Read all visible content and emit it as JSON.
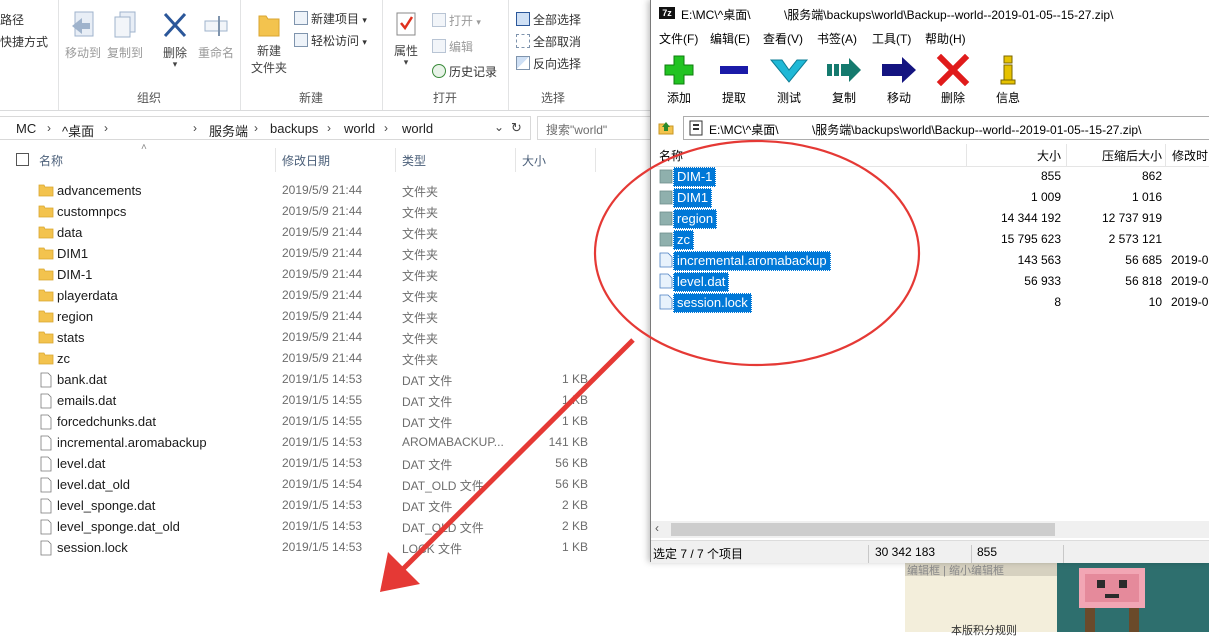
{
  "explorer": {
    "ribbon": {
      "left_edge": {
        "path_label": "路径",
        "shortcut_label": "快捷方式"
      },
      "organize": {
        "group_label": "组织",
        "move_to": "移动到",
        "copy_to": "复制到",
        "delete": "删除",
        "rename": "重命名"
      },
      "new": {
        "group_label": "新建",
        "new_folder_line1": "新建",
        "new_folder_line2": "文件夹",
        "new_item": "新建项目",
        "easy_access": "轻松访问"
      },
      "open": {
        "group_label": "打开",
        "properties": "属性",
        "open": "打开",
        "edit": "编辑",
        "history": "历史记录"
      },
      "select": {
        "group_label": "选择",
        "select_all": "全部选择",
        "select_none": "全部取消",
        "invert": "反向选择"
      }
    },
    "address": {
      "segments": [
        "MC",
        "^桌面",
        "服务端",
        "backups",
        "world",
        "world"
      ],
      "search_placeholder": "搜索\"world\""
    },
    "columns": {
      "name": "名称",
      "date": "修改日期",
      "type": "类型",
      "size": "大小"
    },
    "files": [
      {
        "name": "advancements",
        "date": "2019/5/9 21:44",
        "type": "文件夹",
        "size": "",
        "kind": "folder"
      },
      {
        "name": "customnpcs",
        "date": "2019/5/9 21:44",
        "type": "文件夹",
        "size": "",
        "kind": "folder"
      },
      {
        "name": "data",
        "date": "2019/5/9 21:44",
        "type": "文件夹",
        "size": "",
        "kind": "folder"
      },
      {
        "name": "DIM1",
        "date": "2019/5/9 21:44",
        "type": "文件夹",
        "size": "",
        "kind": "folder"
      },
      {
        "name": "DIM-1",
        "date": "2019/5/9 21:44",
        "type": "文件夹",
        "size": "",
        "kind": "folder"
      },
      {
        "name": "playerdata",
        "date": "2019/5/9 21:44",
        "type": "文件夹",
        "size": "",
        "kind": "folder"
      },
      {
        "name": "region",
        "date": "2019/5/9 21:44",
        "type": "文件夹",
        "size": "",
        "kind": "folder"
      },
      {
        "name": "stats",
        "date": "2019/5/9 21:44",
        "type": "文件夹",
        "size": "",
        "kind": "folder"
      },
      {
        "name": "zc",
        "date": "2019/5/9 21:44",
        "type": "文件夹",
        "size": "",
        "kind": "folder"
      },
      {
        "name": "bank.dat",
        "date": "2019/1/5 14:53",
        "type": "DAT 文件",
        "size": "1 KB",
        "kind": "file"
      },
      {
        "name": "emails.dat",
        "date": "2019/1/5 14:55",
        "type": "DAT 文件",
        "size": "1 KB",
        "kind": "file"
      },
      {
        "name": "forcedchunks.dat",
        "date": "2019/1/5 14:55",
        "type": "DAT 文件",
        "size": "1 KB",
        "kind": "file"
      },
      {
        "name": "incremental.aromabackup",
        "date": "2019/1/5 14:53",
        "type": "AROMABACKUP...",
        "size": "141 KB",
        "kind": "file"
      },
      {
        "name": "level.dat",
        "date": "2019/1/5 14:53",
        "type": "DAT 文件",
        "size": "56 KB",
        "kind": "file"
      },
      {
        "name": "level.dat_old",
        "date": "2019/1/5 14:54",
        "type": "DAT_OLD 文件",
        "size": "56 KB",
        "kind": "file"
      },
      {
        "name": "level_sponge.dat",
        "date": "2019/1/5 14:53",
        "type": "DAT 文件",
        "size": "2 KB",
        "kind": "file"
      },
      {
        "name": "level_sponge.dat_old",
        "date": "2019/1/5 14:53",
        "type": "DAT_OLD 文件",
        "size": "2 KB",
        "kind": "file"
      },
      {
        "name": "session.lock",
        "date": "2019/1/5 14:53",
        "type": "LOCK 文件",
        "size": "1 KB",
        "kind": "file"
      }
    ]
  },
  "sevenzip": {
    "title": "E:\\MC\\^桌面\\          \\服务端\\backups\\world\\Backup--world--2019-01-05--15-27.zip\\",
    "app_icon_text": "7z",
    "menu": [
      "文件(F)",
      "编辑(E)",
      "查看(V)",
      "书签(A)",
      "工具(T)",
      "帮助(H)"
    ],
    "toolbar": [
      {
        "label": "添加",
        "icon": "plus-icon",
        "color": "#22c322"
      },
      {
        "label": "提取",
        "icon": "minus-icon",
        "color": "#1a1aa8"
      },
      {
        "label": "测试",
        "icon": "check-icon",
        "color": "#1fb8d6"
      },
      {
        "label": "复制",
        "icon": "copy-arrow-icon",
        "color": "#157a6e"
      },
      {
        "label": "移动",
        "icon": "move-arrow-icon",
        "color": "#141480"
      },
      {
        "label": "删除",
        "icon": "x-icon",
        "color": "#e01b1b"
      },
      {
        "label": "信息",
        "icon": "info-icon",
        "color": "#e6c200"
      }
    ],
    "address": "E:\\MC\\^桌面\\          \\服务端\\backups\\world\\Backup--world--2019-01-05--15-27.zip\\",
    "columns": {
      "name": "名称",
      "size": "大小",
      "packed": "压缩后大小",
      "modified": "修改时"
    },
    "items": [
      {
        "name": "DIM-1",
        "size": "855",
        "packed": "862",
        "modified": "",
        "kind": "folder"
      },
      {
        "name": "DIM1",
        "size": "1 009",
        "packed": "1 016",
        "modified": "",
        "kind": "folder"
      },
      {
        "name": "region",
        "size": "14 344 192",
        "packed": "12 737 919",
        "modified": "",
        "kind": "folder"
      },
      {
        "name": "zc",
        "size": "15 795 623",
        "packed": "2 573 121",
        "modified": "",
        "kind": "folder"
      },
      {
        "name": "incremental.aromabackup",
        "size": "143 563",
        "packed": "56 685",
        "modified": "2019-0",
        "kind": "file"
      },
      {
        "name": "level.dat",
        "size": "56 933",
        "packed": "56 818",
        "modified": "2019-0",
        "kind": "file"
      },
      {
        "name": "session.lock",
        "size": "8",
        "packed": "10",
        "modified": "2019-0",
        "kind": "file"
      }
    ],
    "status": {
      "selected": "选定 7 / 7 个项目",
      "total": "30 342 183",
      "selected_size": "855"
    }
  },
  "background_page": {
    "tabs_text": "编辑框 | 缩小编辑框",
    "note": "本版积分规则"
  },
  "colors": {
    "selection": "#0078d7",
    "annotation": "#e53935"
  }
}
